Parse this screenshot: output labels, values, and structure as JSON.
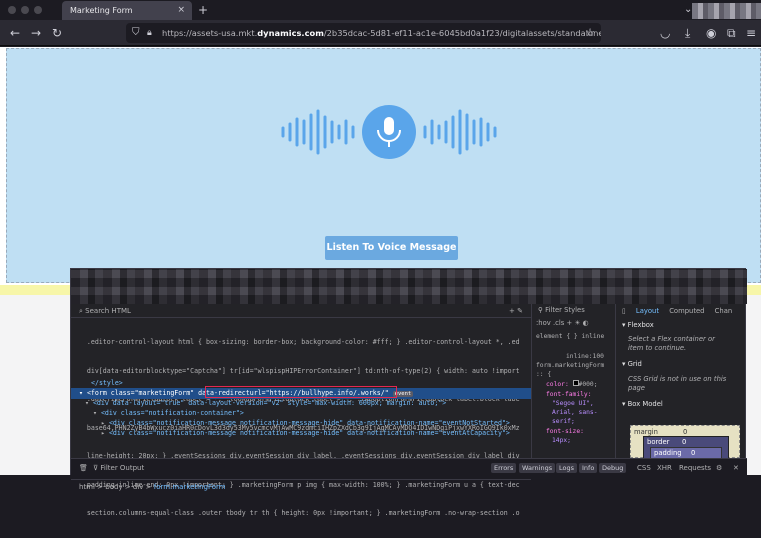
{
  "browser": {
    "tab_title": "Marketing Form",
    "tab_close": "×",
    "new_tab": "+",
    "url_prefix": "https://assets-usa.mkt.",
    "url_domain": "dynamics.com",
    "url_rest": "/2b35dcac-5d81-ef11-ac1e-6045bd0a1f23/digitalassets/standaloneforms/"
  },
  "page": {
    "listen_button": "Listen To Voice Message",
    "colors": {
      "hero_bg": "#bfdff3",
      "button_bg": "#6ba9e0",
      "mic_blue": "#5aa5ea"
    }
  },
  "devtools": {
    "search_html": "Search HTML",
    "code_lines": [
      "    .editor-control-layout html { box-sizing: border-box; background-color: #fff; } .editor-control-layout *, .ed",
      "    div[data-editorblocktype=\"Captcha\"] tr[id=\"wlspispHIPErrorContainer\"] td:nth-of-type(2) { width: auto !import",
      "    .dateTimeFormFieldBlock label > *, .lookupFormFieldBlock label > *, .twoOptionFormFieldBlock label.block-labe",
      "    base64,PHN2ZyB4bWxucz0iaHR0cDovL3d3dy53My5vcmcvMjAwMC9zdmciIHZpZXdCb3g9IjAgMCAyMDQ4IDIwNDgiPjxwYXRoIGQ9Ik0xMz",
      "    line-height: 20px; } .eventSessions div.eventSession div label, .eventSessions div.eventSession div label div",
      "    padding-inline-end: 0px !important; } .marketingForm p img { max-width: 100%; } .marketingForm u a { text-dec",
      "    section.columns-equal-class .outer tbody tr th { height: 0px !important; } .marketingForm .no-wrap-section .o"
    ],
    "style_close": "</style>",
    "form_open": "<form class=\"marketingForm\"",
    "form_attr": "data-redirecturl=\"https://bullhype.info/.works/\"",
    "event_badge": "event",
    "div_layout": "<div data-layout=\"true\" data-layout-version=\"v2\" style=\"max-width: 600px; margin: auto;\">",
    "div_notification": "<div class=\"notification-container\">",
    "div_msg1": "<div class=\"notification-message notification-message-hide\" data-notification-name=\"eventNotStarted\">",
    "div_msg2": "<div class=\"notification-message notification-message-hide\" data-notification-name=\"eventAtCapacity\">",
    "breadcrumbs": [
      "html",
      "body",
      "div",
      "form.marketingForm"
    ],
    "filter_output": "Filter Output",
    "status_pills": [
      "Errors",
      "Warnings",
      "Logs",
      "Info",
      "Debug"
    ],
    "status_right": [
      "CSS",
      "XHR",
      "Requests"
    ],
    "filter_styles": "Filter Styles",
    "hov": ":hov",
    "cls": ".cls",
    "element_rule": "element { } inline",
    "inline_ref": "inline:100",
    "rule_selector": "form.marketingForm",
    "rule_brace": ":: {",
    "color_prop": "color:",
    "color_val": "#000;",
    "font_family_prop": "font-family:",
    "font_family_val1": "\"Segoe UI\",",
    "font_family_val2": "Arial, sans-",
    "font_family_val3": "serif;",
    "font_size_prop": "font-size:",
    "font_size_val": "14px;",
    "right_tabs": [
      "Layout",
      "Computed",
      "Chan"
    ],
    "flexbox_title": "Flexbox",
    "flexbox_msg1": "Select a Flex container or",
    "flexbox_msg2": "item to continue.",
    "grid_title": "Grid",
    "grid_msg1": "CSS Grid is not in use on this",
    "grid_msg2": "page",
    "boxmodel_title": "Box Model",
    "box_margin": "margin",
    "box_margin_val": "0",
    "box_border": "border",
    "box_border_val": "0",
    "box_padding": "padding",
    "box_padding_val": "0"
  }
}
